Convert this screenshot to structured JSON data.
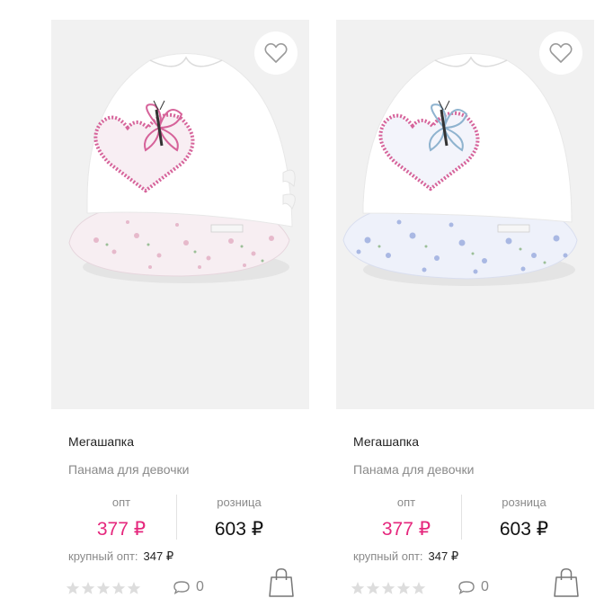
{
  "products": [
    {
      "brand": "Мегашапка",
      "description": "Панама для девочки",
      "opt_label": "опт",
      "opt_price": "377 ₽",
      "retail_label": "розница",
      "retail_price": "603 ₽",
      "bulk_label": "крупный опт:",
      "bulk_price": "347 ₽",
      "rating": 0,
      "comments_count": "0",
      "accent_color": "#d6639a",
      "print_color": "#e6b9cb",
      "brim_color": "#f6eef2"
    },
    {
      "brand": "Мегашапка",
      "description": "Панама для девочки",
      "opt_label": "опт",
      "opt_price": "377 ₽",
      "retail_label": "розница",
      "retail_price": "603 ₽",
      "bulk_label": "крупный опт:",
      "bulk_price": "347 ₽",
      "rating": 0,
      "comments_count": "0",
      "accent_color": "#d6639a",
      "print_color": "#a9b8e3",
      "brim_color": "#eef1fa"
    }
  ],
  "colors": {
    "opt_price": "#e5277d",
    "retail_price": "#111111",
    "muted_text": "#8a8a8a",
    "image_bg": "#f1f1f1",
    "star_empty": "#dddddd"
  },
  "icons": [
    "heart-icon",
    "star-icon",
    "comment-icon",
    "shopping-bag-icon"
  ]
}
